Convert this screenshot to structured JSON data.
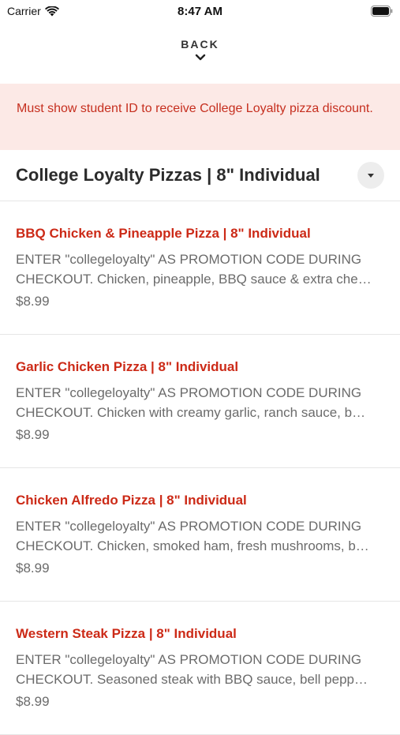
{
  "status": {
    "carrier": "Carrier",
    "time": "8:47 AM"
  },
  "nav": {
    "back_label": "BACK"
  },
  "notice": "Must show student ID to receive College Loyalty pizza discount.",
  "category": {
    "title": "College Loyalty Pizzas | 8\" Individual"
  },
  "colors": {
    "accent": "#cc2a17",
    "notice_bg": "#fce9e6"
  },
  "items": [
    {
      "name": "BBQ Chicken & Pineapple Pizza | 8\" Individual",
      "description": "ENTER \"collegeloyalty\" AS PROMOTION CODE DURING CHECKOUT. Chicken, pineapple, BBQ sauce & extra che…",
      "price": "$8.99"
    },
    {
      "name": "Garlic Chicken Pizza | 8\" Individual",
      "description": "ENTER \"collegeloyalty\" AS PROMOTION CODE DURING CHECKOUT. Chicken with creamy garlic, ranch sauce, b…",
      "price": "$8.99"
    },
    {
      "name": "Chicken Alfredo Pizza | 8\" Individual",
      "description": "ENTER \"collegeloyalty\" AS PROMOTION CODE DURING CHECKOUT. Chicken, smoked ham, fresh mushrooms, b…",
      "price": "$8.99"
    },
    {
      "name": "Western Steak Pizza | 8\" Individual",
      "description": "ENTER \"collegeloyalty\" AS PROMOTION CODE DURING CHECKOUT. Seasoned steak with BBQ sauce, bell pepp…",
      "price": "$8.99"
    }
  ]
}
